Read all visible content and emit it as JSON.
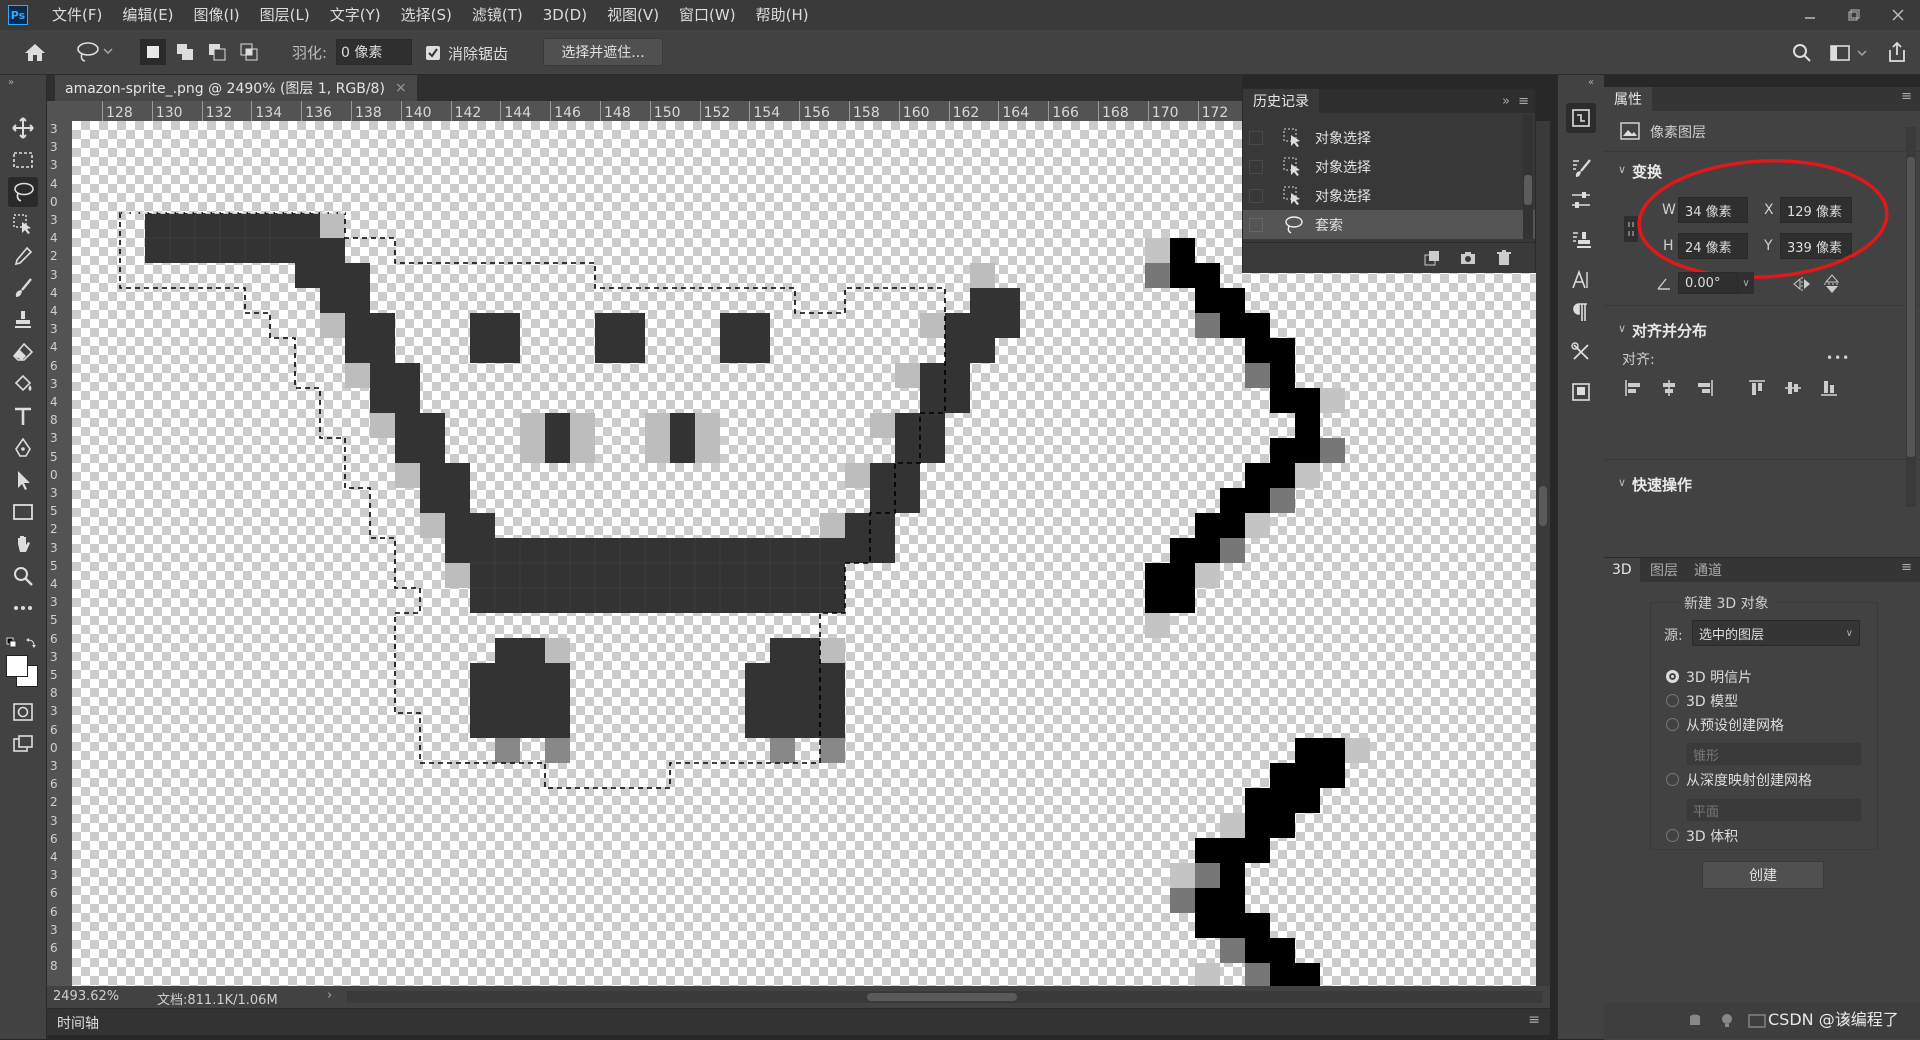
{
  "menubar": {
    "logo": "Ps",
    "items": [
      "文件(F)",
      "编辑(E)",
      "图像(I)",
      "图层(L)",
      "文字(Y)",
      "选择(S)",
      "滤镜(T)",
      "3D(D)",
      "视图(V)",
      "窗口(W)",
      "帮助(H)"
    ]
  },
  "options": {
    "feather_label": "羽化:",
    "feather_value": "0 像素",
    "antialias_label": "消除锯齿",
    "select_mask_button": "选择并遮住..."
  },
  "document": {
    "tab_title": "amazon-sprite_.png @ 2490% (图层 1, RGB/8)",
    "close": "×",
    "ruler_h": [
      "128",
      "130",
      "132",
      "134",
      "136",
      "138",
      "140",
      "142",
      "144",
      "146",
      "148",
      "150",
      "152",
      "154",
      "156",
      "158",
      "160",
      "162",
      "164",
      "166",
      "168",
      "170",
      "172"
    ],
    "ruler_v": [
      "3",
      "3",
      "3",
      "4",
      "0",
      "3",
      "4",
      "2",
      "3",
      "4",
      "4",
      "3",
      "4",
      "6",
      "3",
      "4",
      "8",
      "3",
      "5",
      "0",
      "3",
      "5",
      "2",
      "3",
      "5",
      "4",
      "3",
      "5",
      "6",
      "3",
      "5",
      "8",
      "3",
      "6",
      "0",
      "3",
      "6",
      "2",
      "3",
      "6",
      "4",
      "3",
      "6",
      "6",
      "3",
      "6",
      "8"
    ],
    "zoom": "2493.62%",
    "doc_size": "文档:811.1K/1.06M",
    "status_arrow": "›"
  },
  "timeline": {
    "label": "时间轴"
  },
  "history": {
    "title": "历史记录",
    "items": [
      {
        "label": "对象选择",
        "selected": false
      },
      {
        "label": "对象选择",
        "selected": false
      },
      {
        "label": "对象选择",
        "selected": false
      },
      {
        "label": "套索",
        "selected": true
      }
    ]
  },
  "properties": {
    "title": "属性",
    "layer_type": "像素图层",
    "transform_title": "变换",
    "w_label": "W",
    "w_value": "34 像素",
    "h_label": "H",
    "h_value": "24 像素",
    "x_label": "X",
    "x_value": "129 像素",
    "y_label": "Y",
    "y_value": "339 像素",
    "angle_value": "0.00°",
    "align_title": "对齐并分布",
    "align_label": "对齐:",
    "more": "•••",
    "quick_title": "快速操作"
  },
  "panel3d": {
    "tabs": [
      "3D",
      "图层",
      "通道"
    ],
    "group_title": "新建 3D 对象",
    "source_label": "源:",
    "source_value": "选中的图层",
    "options": [
      {
        "label": "3D 明信片",
        "checked": true
      },
      {
        "label": "3D 模型",
        "checked": false
      },
      {
        "label": "从预设创建网格",
        "checked": false
      },
      {
        "label": "从深度映射创建网格",
        "checked": false
      },
      {
        "label": "3D 体积",
        "checked": false
      }
    ],
    "preset_value": "锥形",
    "depth_value": "平面",
    "create_button": "创建"
  },
  "watermark": "CSDN @该编程了",
  "colors": {
    "annotation": "#e01818",
    "sprite_dark": "#333333",
    "sprite_black": "#000000"
  }
}
